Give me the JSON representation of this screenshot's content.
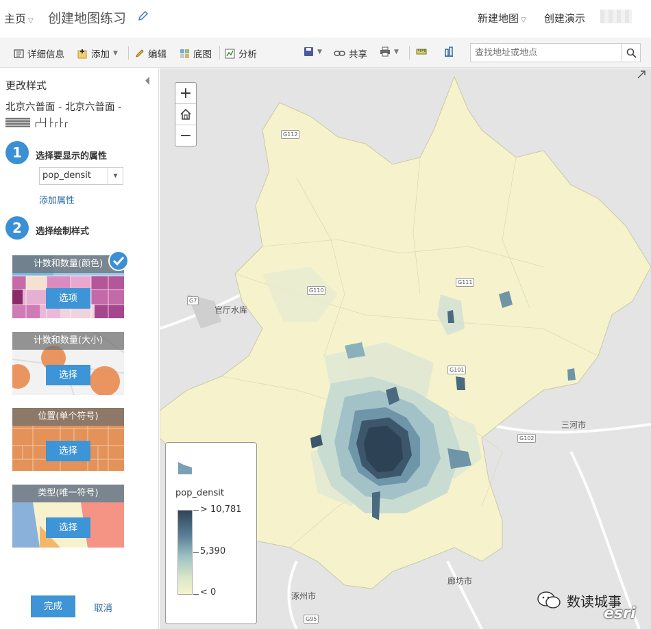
{
  "header": {
    "home": "主页",
    "title": "创建地图练习",
    "new_map": "新建地图",
    "create_presentation": "创建演示"
  },
  "toolbar": {
    "details": "详细信息",
    "add": "添加",
    "edit": "编辑",
    "basemap": "底图",
    "analysis": "分析",
    "share": "共享",
    "search_placeholder": "查找地址或地点"
  },
  "panel": {
    "title": "更改样式",
    "layer_name": "北京六普面 - 北京六普面 -",
    "layer_suffix": "┌┴┤├┌├┌",
    "step1": {
      "number": "1",
      "label": "选择要显示的属性"
    },
    "attribute_value": "pop_densit",
    "add_attribute": "添加属性",
    "step2": {
      "number": "2",
      "label": "选择绘制样式"
    },
    "styles": [
      {
        "title": "计数和数量(颜色)",
        "button": "选项"
      },
      {
        "title": "计数和数量(大小)",
        "button": "选择"
      },
      {
        "title": "位置(单个符号)",
        "button": "选择"
      },
      {
        "title": "类型(唯一符号)",
        "button": "选择"
      }
    ],
    "done": "完成",
    "cancel": "取消"
  },
  "map": {
    "legend": {
      "field": "pop_densit",
      "max": "> 10,781",
      "mid": "5,390",
      "min": "< 0"
    },
    "places": [
      "官厅水库",
      "三河市",
      "廊坊市",
      "涿州市"
    ],
    "roads": [
      "G112",
      "G7",
      "G110",
      "G111",
      "G101",
      "G102",
      "G95"
    ],
    "watermark": "数读城事",
    "brand": "esri"
  },
  "colors": {
    "accent": "#3d94d6",
    "link": "#2a6aa5",
    "ramp_high": "#2f4458",
    "ramp_low": "#f8f4cc"
  }
}
